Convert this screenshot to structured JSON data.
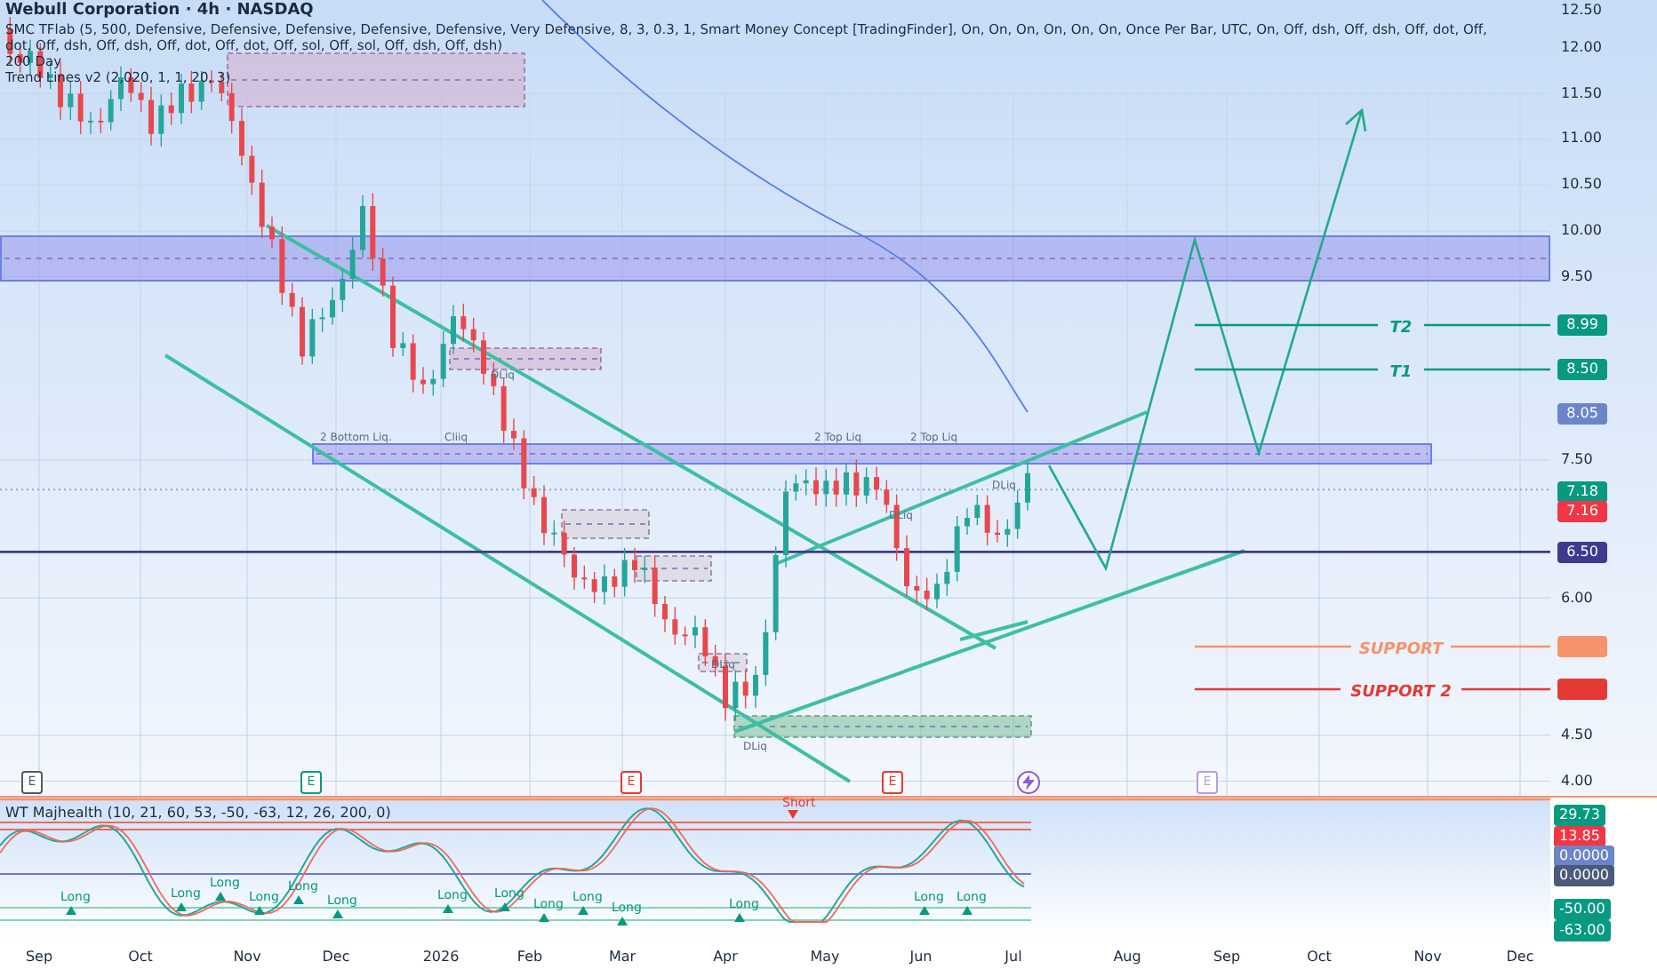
{
  "legend": {
    "title": "Webull Corporation · 4h · NASDAQ",
    "indicators": [
      "SMC TFlab (5, 500, Defensive, Defensive, Defensive, Defensive, Defensive, Very Defensive, 8, 3, 0.3, 1, Smart Money Concept [TradingFinder], On, On, On, On, On, On, Once Per Bar, UTC, On, Off, dsh, Off, dsh, Off, dot, Off, dot, Off, dsh, Off, dsh, Off, dot, Off, dot, Off, sol, Off, sol, Off, dsh, Off, dsh)",
      "200 Day",
      "Trend Lines v2 (2,020, 1, 1, 20, 3)"
    ]
  },
  "price_chart": {
    "price_axis_labels": [
      "12.50",
      "12.00",
      "11.50",
      "11.00",
      "10.50",
      "10.00",
      "9.50",
      "7.50",
      "6.00",
      "4.50",
      "4.00"
    ],
    "time_axis_labels": [
      "Sep",
      "Oct",
      "Nov",
      "Dec",
      "2026",
      "Feb",
      "Mar",
      "Apr",
      "May",
      "Jun",
      "Jul",
      "Aug",
      "Sep",
      "Oct",
      "Nov",
      "Dec"
    ],
    "annotations": [
      "2 Bottom Liq.",
      "Cliiq",
      "DLiq",
      "2 Top Liq",
      "2 Top Liq",
      "DLiq",
      "DLiq",
      "DLiq",
      "DLiq"
    ],
    "levels": [
      {
        "label": "T2",
        "color": "#089981"
      },
      {
        "label": "T1",
        "color": "#089981"
      },
      {
        "label": "SUPPORT",
        "color": "#f7936b"
      },
      {
        "label": "SUPPORT 2",
        "color": "#e53935"
      }
    ],
    "price_badges": [
      {
        "text": "8.99",
        "color": "#089981"
      },
      {
        "text": "8.50",
        "color": "#089981"
      },
      {
        "text": "8.05",
        "color": "#6b85c8"
      },
      {
        "text": "7.18",
        "color": "#089981"
      },
      {
        "text": "7.16",
        "color": "#f23645"
      },
      {
        "text": "6.50",
        "color": "#3f3a8f"
      }
    ],
    "events": [
      {
        "kind": "earnings",
        "label": "E",
        "color": "#555a66"
      },
      {
        "kind": "earnings",
        "label": "E",
        "color": "#089981"
      },
      {
        "kind": "earnings",
        "label": "E",
        "color": "#e53935"
      },
      {
        "kind": "earnings",
        "label": "E",
        "color": "#e53935"
      },
      {
        "kind": "dividend",
        "color": "#8e5bd6"
      },
      {
        "kind": "earnings",
        "label": "E",
        "color": "#b79be8"
      }
    ]
  },
  "oscillator": {
    "title": "WT Majhealth (10, 21, 60, 53, -50, -63, 12, 26, 200, 0)",
    "signals": [
      {
        "kind": "short",
        "label": "Short"
      },
      {
        "kind": "long",
        "label": "Long"
      },
      {
        "kind": "long",
        "label": "Long"
      },
      {
        "kind": "long",
        "label": "Long"
      },
      {
        "kind": "long",
        "label": "Long"
      },
      {
        "kind": "long",
        "label": "Long"
      },
      {
        "kind": "long",
        "label": "Long"
      },
      {
        "kind": "long",
        "label": "Long"
      },
      {
        "kind": "long",
        "label": "Long"
      },
      {
        "kind": "long",
        "label": "Long"
      },
      {
        "kind": "long",
        "label": "Long"
      },
      {
        "kind": "long",
        "label": "Long"
      },
      {
        "kind": "long",
        "label": "Long"
      },
      {
        "kind": "long",
        "label": "Long"
      },
      {
        "kind": "long",
        "label": "Long"
      }
    ],
    "axis_badges": [
      {
        "text": "29.73",
        "color": "#089981"
      },
      {
        "text": "13.85",
        "color": "#f23645"
      },
      {
        "text": "0.0000",
        "color": "#6b85c8"
      },
      {
        "text": "0.0000",
        "color": "#4a5a78"
      },
      {
        "text": "-50.00",
        "color": "#089981"
      },
      {
        "text": "-63.00",
        "color": "#089981"
      }
    ]
  }
}
